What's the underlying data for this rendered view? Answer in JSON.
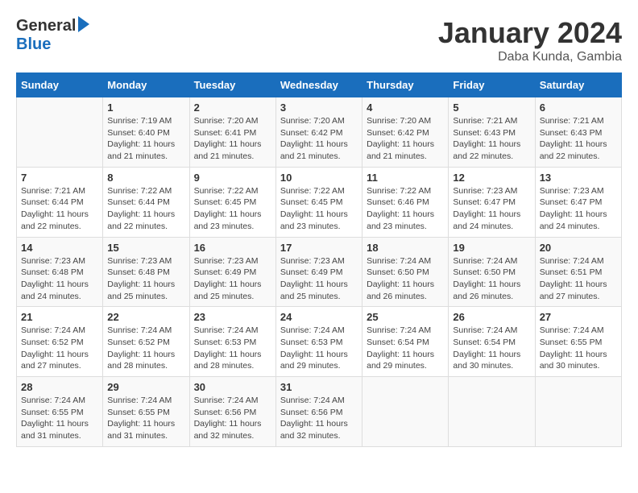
{
  "header": {
    "logo_general": "General",
    "logo_blue": "Blue",
    "month_title": "January 2024",
    "location": "Daba Kunda, Gambia"
  },
  "days_of_week": [
    "Sunday",
    "Monday",
    "Tuesday",
    "Wednesday",
    "Thursday",
    "Friday",
    "Saturday"
  ],
  "weeks": [
    [
      {
        "day": "",
        "sunrise": "",
        "sunset": "",
        "daylight": ""
      },
      {
        "day": "1",
        "sunrise": "Sunrise: 7:19 AM",
        "sunset": "Sunset: 6:40 PM",
        "daylight": "Daylight: 11 hours and 21 minutes."
      },
      {
        "day": "2",
        "sunrise": "Sunrise: 7:20 AM",
        "sunset": "Sunset: 6:41 PM",
        "daylight": "Daylight: 11 hours and 21 minutes."
      },
      {
        "day": "3",
        "sunrise": "Sunrise: 7:20 AM",
        "sunset": "Sunset: 6:42 PM",
        "daylight": "Daylight: 11 hours and 21 minutes."
      },
      {
        "day": "4",
        "sunrise": "Sunrise: 7:20 AM",
        "sunset": "Sunset: 6:42 PM",
        "daylight": "Daylight: 11 hours and 21 minutes."
      },
      {
        "day": "5",
        "sunrise": "Sunrise: 7:21 AM",
        "sunset": "Sunset: 6:43 PM",
        "daylight": "Daylight: 11 hours and 22 minutes."
      },
      {
        "day": "6",
        "sunrise": "Sunrise: 7:21 AM",
        "sunset": "Sunset: 6:43 PM",
        "daylight": "Daylight: 11 hours and 22 minutes."
      }
    ],
    [
      {
        "day": "7",
        "sunrise": "Sunrise: 7:21 AM",
        "sunset": "Sunset: 6:44 PM",
        "daylight": "Daylight: 11 hours and 22 minutes."
      },
      {
        "day": "8",
        "sunrise": "Sunrise: 7:22 AM",
        "sunset": "Sunset: 6:44 PM",
        "daylight": "Daylight: 11 hours and 22 minutes."
      },
      {
        "day": "9",
        "sunrise": "Sunrise: 7:22 AM",
        "sunset": "Sunset: 6:45 PM",
        "daylight": "Daylight: 11 hours and 23 minutes."
      },
      {
        "day": "10",
        "sunrise": "Sunrise: 7:22 AM",
        "sunset": "Sunset: 6:45 PM",
        "daylight": "Daylight: 11 hours and 23 minutes."
      },
      {
        "day": "11",
        "sunrise": "Sunrise: 7:22 AM",
        "sunset": "Sunset: 6:46 PM",
        "daylight": "Daylight: 11 hours and 23 minutes."
      },
      {
        "day": "12",
        "sunrise": "Sunrise: 7:23 AM",
        "sunset": "Sunset: 6:47 PM",
        "daylight": "Daylight: 11 hours and 24 minutes."
      },
      {
        "day": "13",
        "sunrise": "Sunrise: 7:23 AM",
        "sunset": "Sunset: 6:47 PM",
        "daylight": "Daylight: 11 hours and 24 minutes."
      }
    ],
    [
      {
        "day": "14",
        "sunrise": "Sunrise: 7:23 AM",
        "sunset": "Sunset: 6:48 PM",
        "daylight": "Daylight: 11 hours and 24 minutes."
      },
      {
        "day": "15",
        "sunrise": "Sunrise: 7:23 AM",
        "sunset": "Sunset: 6:48 PM",
        "daylight": "Daylight: 11 hours and 25 minutes."
      },
      {
        "day": "16",
        "sunrise": "Sunrise: 7:23 AM",
        "sunset": "Sunset: 6:49 PM",
        "daylight": "Daylight: 11 hours and 25 minutes."
      },
      {
        "day": "17",
        "sunrise": "Sunrise: 7:23 AM",
        "sunset": "Sunset: 6:49 PM",
        "daylight": "Daylight: 11 hours and 25 minutes."
      },
      {
        "day": "18",
        "sunrise": "Sunrise: 7:24 AM",
        "sunset": "Sunset: 6:50 PM",
        "daylight": "Daylight: 11 hours and 26 minutes."
      },
      {
        "day": "19",
        "sunrise": "Sunrise: 7:24 AM",
        "sunset": "Sunset: 6:50 PM",
        "daylight": "Daylight: 11 hours and 26 minutes."
      },
      {
        "day": "20",
        "sunrise": "Sunrise: 7:24 AM",
        "sunset": "Sunset: 6:51 PM",
        "daylight": "Daylight: 11 hours and 27 minutes."
      }
    ],
    [
      {
        "day": "21",
        "sunrise": "Sunrise: 7:24 AM",
        "sunset": "Sunset: 6:52 PM",
        "daylight": "Daylight: 11 hours and 27 minutes."
      },
      {
        "day": "22",
        "sunrise": "Sunrise: 7:24 AM",
        "sunset": "Sunset: 6:52 PM",
        "daylight": "Daylight: 11 hours and 28 minutes."
      },
      {
        "day": "23",
        "sunrise": "Sunrise: 7:24 AM",
        "sunset": "Sunset: 6:53 PM",
        "daylight": "Daylight: 11 hours and 28 minutes."
      },
      {
        "day": "24",
        "sunrise": "Sunrise: 7:24 AM",
        "sunset": "Sunset: 6:53 PM",
        "daylight": "Daylight: 11 hours and 29 minutes."
      },
      {
        "day": "25",
        "sunrise": "Sunrise: 7:24 AM",
        "sunset": "Sunset: 6:54 PM",
        "daylight": "Daylight: 11 hours and 29 minutes."
      },
      {
        "day": "26",
        "sunrise": "Sunrise: 7:24 AM",
        "sunset": "Sunset: 6:54 PM",
        "daylight": "Daylight: 11 hours and 30 minutes."
      },
      {
        "day": "27",
        "sunrise": "Sunrise: 7:24 AM",
        "sunset": "Sunset: 6:55 PM",
        "daylight": "Daylight: 11 hours and 30 minutes."
      }
    ],
    [
      {
        "day": "28",
        "sunrise": "Sunrise: 7:24 AM",
        "sunset": "Sunset: 6:55 PM",
        "daylight": "Daylight: 11 hours and 31 minutes."
      },
      {
        "day": "29",
        "sunrise": "Sunrise: 7:24 AM",
        "sunset": "Sunset: 6:55 PM",
        "daylight": "Daylight: 11 hours and 31 minutes."
      },
      {
        "day": "30",
        "sunrise": "Sunrise: 7:24 AM",
        "sunset": "Sunset: 6:56 PM",
        "daylight": "Daylight: 11 hours and 32 minutes."
      },
      {
        "day": "31",
        "sunrise": "Sunrise: 7:24 AM",
        "sunset": "Sunset: 6:56 PM",
        "daylight": "Daylight: 11 hours and 32 minutes."
      },
      {
        "day": "",
        "sunrise": "",
        "sunset": "",
        "daylight": ""
      },
      {
        "day": "",
        "sunrise": "",
        "sunset": "",
        "daylight": ""
      },
      {
        "day": "",
        "sunrise": "",
        "sunset": "",
        "daylight": ""
      }
    ]
  ]
}
